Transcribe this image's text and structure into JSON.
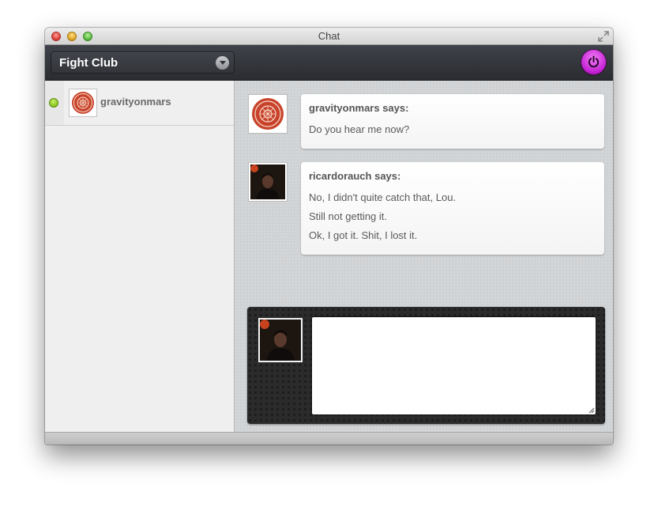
{
  "window": {
    "title": "Chat"
  },
  "toolbar": {
    "room_name": "Fight Club"
  },
  "sidebar": {
    "users": [
      {
        "name": "gravityonmars",
        "status": "online",
        "status_color": "#86c21c"
      }
    ]
  },
  "messages": [
    {
      "author": "gravityonmars says:",
      "lines": [
        "Do you hear me now?"
      ]
    },
    {
      "author": "ricardorauch says:",
      "lines": [
        "No, I didn't quite catch that, Lou.",
        "Still not getting it.",
        "Ok, I got it. Shit, I lost it."
      ]
    }
  ],
  "composer": {
    "value": ""
  },
  "colors": {
    "power_button": "#c11ed2",
    "toolbar": "#2f3136",
    "chat_background": "#cfd2d4"
  }
}
